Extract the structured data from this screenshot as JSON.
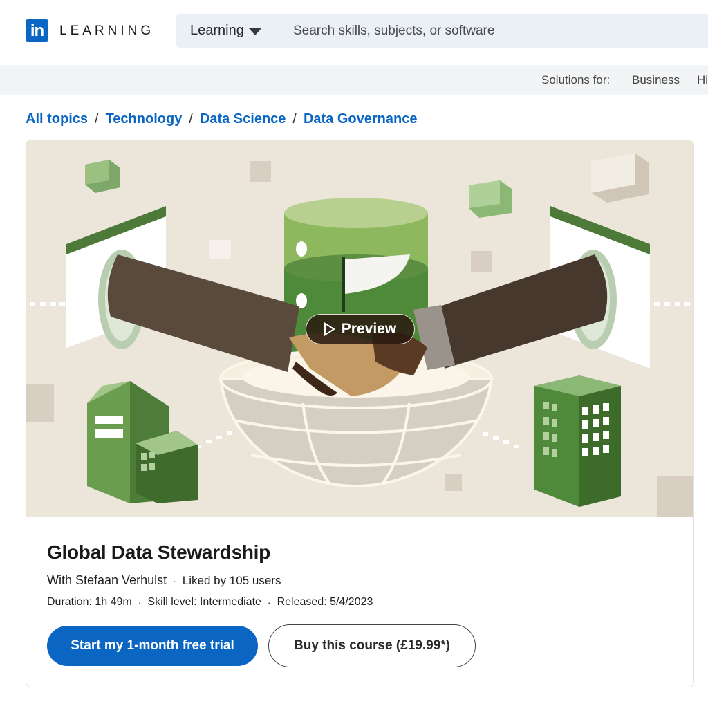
{
  "header": {
    "logo_mark": "in",
    "logo_text": "LEARNING",
    "search_scope": "Learning",
    "search_placeholder": "Search skills, subjects, or software",
    "brand_color": "#0a66c2"
  },
  "solutions_bar": {
    "label": "Solutions for:",
    "links": [
      "Business",
      "Hi"
    ]
  },
  "breadcrumb": [
    "All topics",
    "Technology",
    "Data Science",
    "Data Governance"
  ],
  "course": {
    "preview_label": "Preview",
    "title": "Global Data Stewardship",
    "instructor": "With Stefaan Verhulst",
    "likes": "Liked by 105 users",
    "duration": "Duration: 1h 49m",
    "skill_level": "Skill level: Intermediate",
    "released": "Released: 5/4/2023",
    "primary_cta": "Start my 1-month free trial",
    "secondary_cta": "Buy this course (£19.99*)"
  }
}
